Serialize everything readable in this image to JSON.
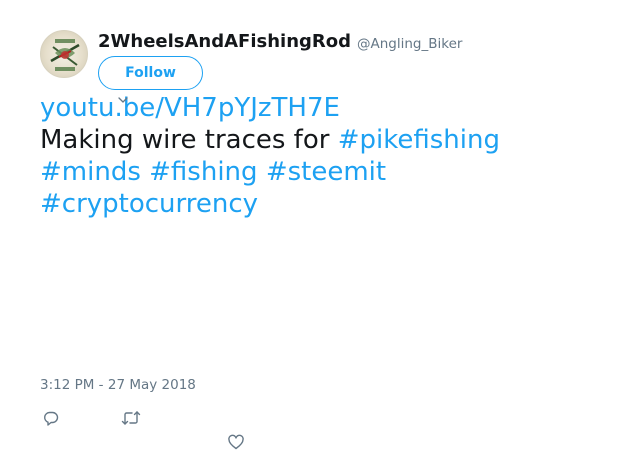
{
  "user": {
    "display_name": "2WheelsAndAFishingRod",
    "handle": "@Angling_Biker",
    "avatar_icon": "profile-avatar-image"
  },
  "follow_button": {
    "label": "Follow"
  },
  "tweet": {
    "link": "youtu.be/VH7pYJzTH7E",
    "text_prefix": "Making wire traces for ",
    "hashtags": [
      "#pikefishing",
      "#minds",
      "#fishing",
      "#steemit",
      "#cryptocurrency"
    ]
  },
  "timestamp": "3:12 PM - 27 May 2018",
  "actions": {
    "reply_icon": "reply-icon",
    "retweet_icon": "retweet-icon",
    "like_icon": "heart-icon"
  },
  "colors": {
    "accent": "#1da1f2",
    "text": "#14171a",
    "muted": "#657786"
  }
}
